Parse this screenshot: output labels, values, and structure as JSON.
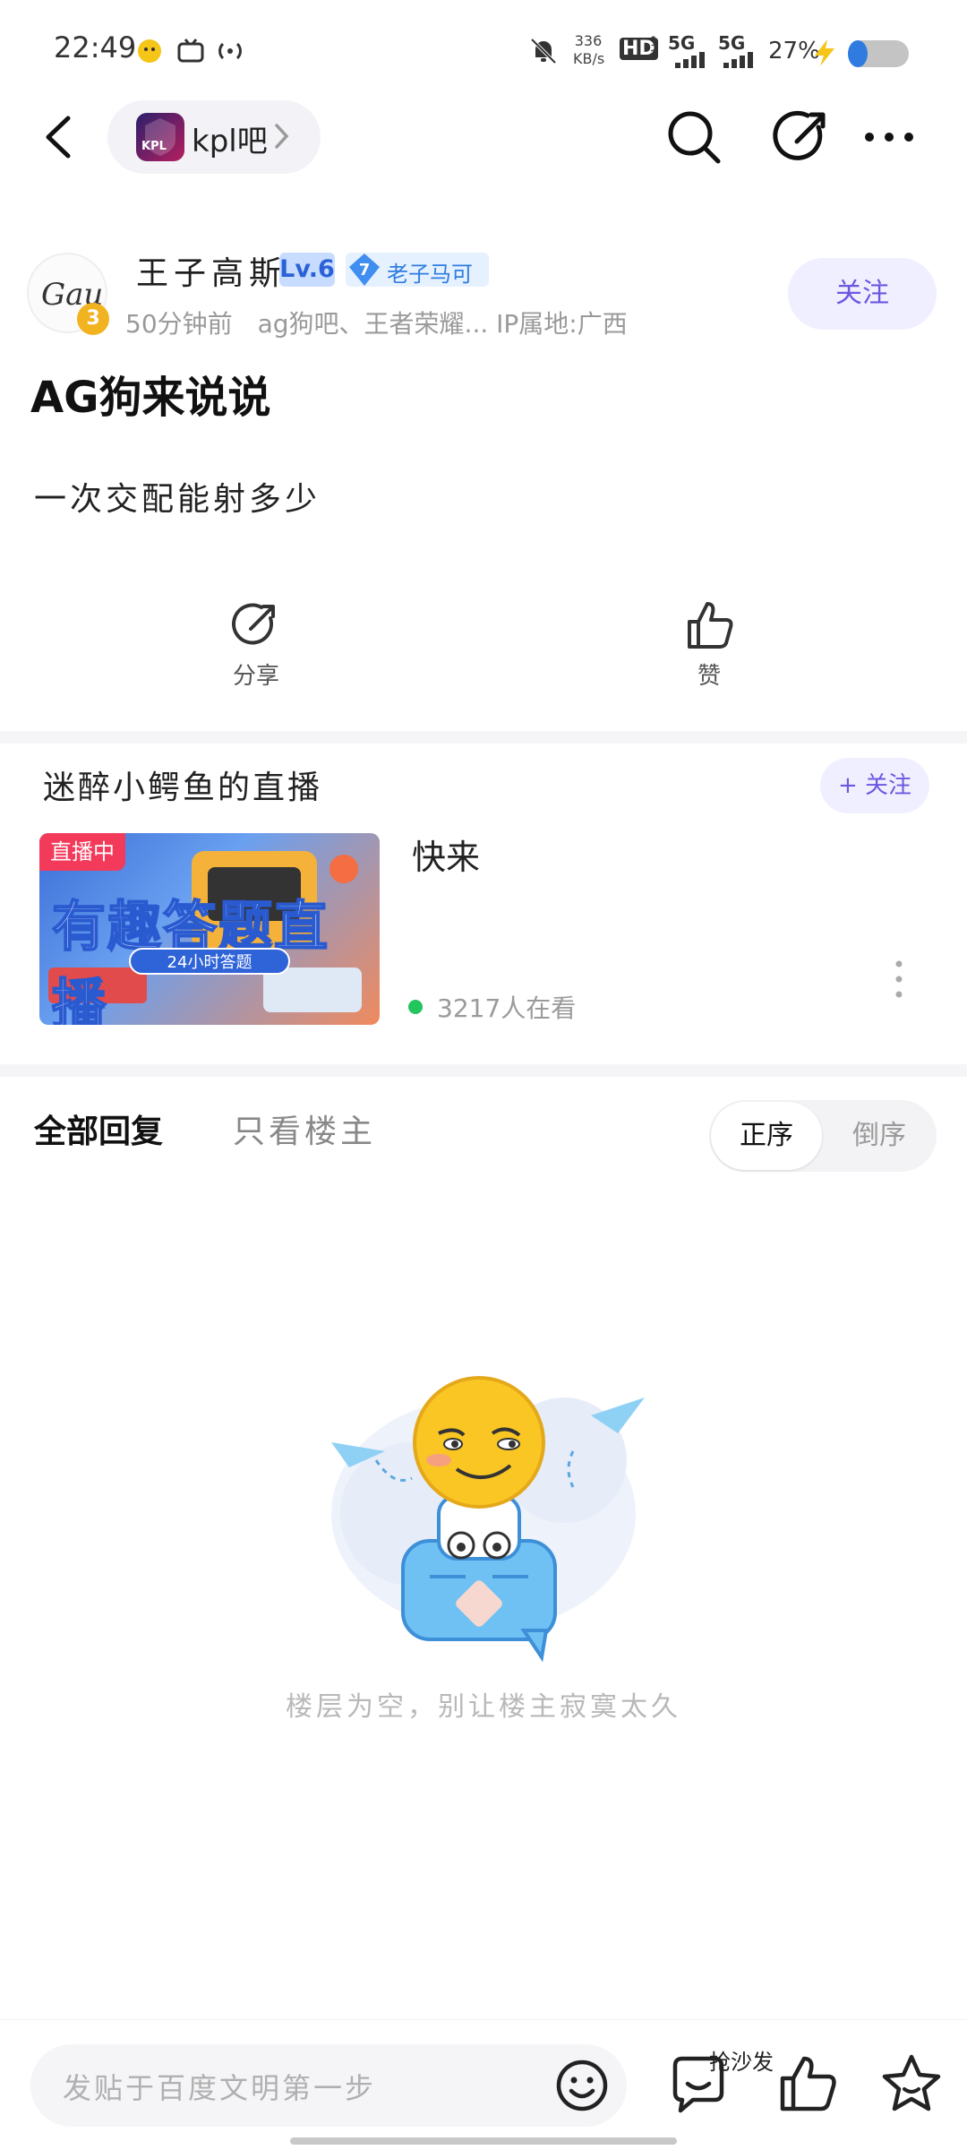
{
  "status_bar": {
    "time": "22:49",
    "net_speed_value": "336",
    "net_speed_unit": "KB/s",
    "hd_label": "HD",
    "hd_sub": "1 2",
    "signal1": "5G",
    "signal2": "5G",
    "battery": "27%"
  },
  "nav": {
    "forum_name": "kpl吧",
    "forum_logo_text": "KPL",
    "icons": [
      "back-icon",
      "search-icon",
      "share-edit-icon",
      "more-icon"
    ]
  },
  "post": {
    "author": {
      "name": "王子高斯",
      "level": "Lv.6",
      "title_rank": "7",
      "title": "老子马可",
      "avatar_badge": "3",
      "avatar_text": "Gauls"
    },
    "meta": "50分钟前　ag狗吧、王者荣耀... IP属地:广西",
    "follow_label": "关注",
    "title": "AG狗来说说",
    "body": "一次交配能射多少",
    "actions": {
      "share_label": "分享",
      "like_label": "赞"
    }
  },
  "live": {
    "section_title": "迷醉小鳄鱼的直播",
    "follow_label": "+ 关注",
    "tag": "直播中",
    "thumb_title": "有趣答题直播",
    "thumb_sub": "24小时答题",
    "stream_title": "快来",
    "viewers": "3217人在看"
  },
  "replies": {
    "tab_all": "全部回复",
    "tab_owner": "只看楼主",
    "sort_asc": "正序",
    "sort_desc": "倒序",
    "empty_text": "楼层为空，别让楼主寂寞太久"
  },
  "bottom_bar": {
    "input_placeholder": "发贴于百度文明第一步",
    "sofa_label": "抢沙发"
  },
  "colors": {
    "accent": "#6b57e0",
    "follow_bg": "#f0efff",
    "live_tag": "#f33a5a",
    "online_dot": "#22c55e",
    "level_badge": "#c8dcff"
  }
}
